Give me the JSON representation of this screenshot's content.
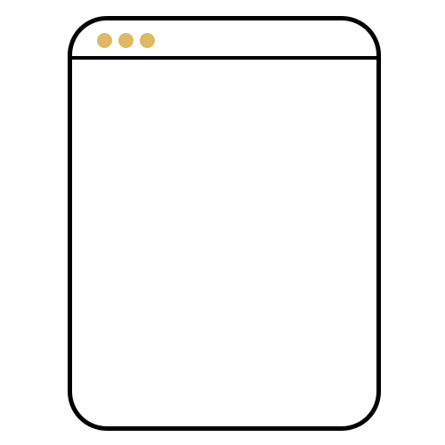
{
  "window": {
    "controls": [
      {
        "icon": "window-control-dot-icon",
        "color": "#dfb862"
      },
      {
        "icon": "window-control-dot-icon",
        "color": "#dfb862"
      },
      {
        "icon": "window-control-dot-icon",
        "color": "#dfb862"
      }
    ],
    "border_color": "#000000",
    "background_color": "#ffffff"
  }
}
